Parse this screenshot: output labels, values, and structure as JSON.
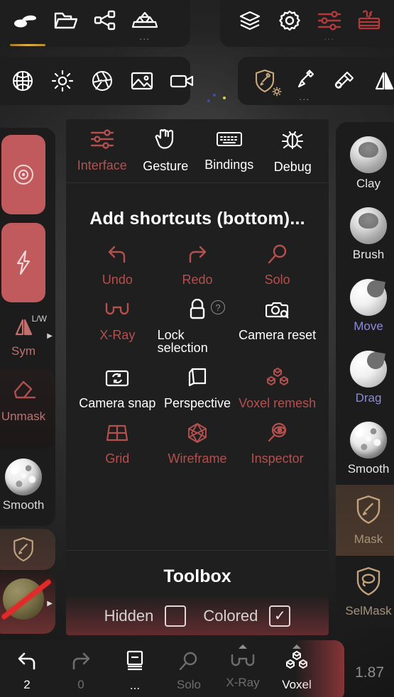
{
  "top_toolbar_left": [
    {
      "label": "Sculpt",
      "icon": "sculpt-shape-icon",
      "active": true
    },
    {
      "label": "Files",
      "icon": "folder-icon",
      "active": false
    },
    {
      "label": "Scene graph",
      "icon": "share-nodes-icon",
      "active": false
    },
    {
      "label": "Primitives",
      "icon": "stack-blocks-icon",
      "active": false,
      "more": "..."
    }
  ],
  "top_toolbar_right": [
    {
      "label": "Layers",
      "icon": "layers-icon",
      "color": "white"
    },
    {
      "label": "Settings",
      "icon": "gear-icon",
      "color": "white"
    },
    {
      "label": "Interface",
      "icon": "sliders-icon",
      "color": "red",
      "more": "..."
    },
    {
      "label": "Toolbox",
      "icon": "toolbox-icon",
      "color": "red"
    }
  ],
  "second_toolbar_left": [
    {
      "label": "Environment",
      "icon": "globe-grid-icon"
    },
    {
      "label": "Light",
      "icon": "sun-icon"
    },
    {
      "label": "Aperture",
      "icon": "aperture-icon"
    },
    {
      "label": "Background image",
      "icon": "image-icon"
    },
    {
      "label": "Video",
      "icon": "video-camera-icon"
    }
  ],
  "second_toolbar_right": [
    {
      "label": "Mask",
      "icon": "shield-brush-icon",
      "color": "gold",
      "badge": "gear-badge"
    },
    {
      "label": "Paint",
      "icon": "paintbrush-icon",
      "color": "white",
      "more": "..."
    },
    {
      "label": "Fill",
      "icon": "paint-bucket-icon",
      "color": "white"
    },
    {
      "label": "Mirror",
      "icon": "mirror-icon",
      "color": "white"
    }
  ],
  "left_sidebar": {
    "sliders": [
      {
        "name": "radius",
        "icon": "radius-target-icon",
        "color": "#c05a5c"
      },
      {
        "name": "intensity",
        "icon": "lightning-bolt-icon",
        "color": "#c05a5c"
      }
    ],
    "symmetry": {
      "label": "Sym",
      "badge": "L/W",
      "icon": "mirror-icon",
      "arrow": "▶"
    },
    "items": [
      {
        "label": "Unmask",
        "icon": "eraser-icon",
        "state": "red"
      },
      {
        "label": "Smooth",
        "icon": "rough-sphere-icon",
        "state": "white"
      },
      {
        "label": "Mask",
        "icon": "shield-brush-icon",
        "state": "selected"
      },
      {
        "label": "Matcap off",
        "icon": "material-sphere-strike-icon",
        "state": "disabled",
        "arrow": "▶"
      }
    ]
  },
  "right_sidebar": {
    "brushes": [
      {
        "label": "Clay",
        "icon": "clay-sphere-icon",
        "selected": false,
        "accent": false
      },
      {
        "label": "Brush",
        "icon": "brush-sphere-icon",
        "selected": false,
        "accent": false
      },
      {
        "label": "Move",
        "icon": "move-sphere-icon",
        "selected": false,
        "accent": true
      },
      {
        "label": "Drag",
        "icon": "drag-sphere-icon",
        "selected": false,
        "accent": true
      },
      {
        "label": "Smooth",
        "icon": "rough-sphere-icon",
        "selected": false,
        "accent": false
      },
      {
        "label": "Mask",
        "icon": "shield-brush-icon",
        "selected": true,
        "accent": false
      },
      {
        "label": "SelMask",
        "icon": "shield-lasso-icon",
        "selected": false,
        "accent": false
      }
    ]
  },
  "panel": {
    "tabs": [
      {
        "label": "Interface",
        "icon": "sliders-icon",
        "active": true
      },
      {
        "label": "Gesture",
        "icon": "hand-gesture-icon",
        "active": false
      },
      {
        "label": "Bindings",
        "icon": "keyboard-icon",
        "active": false
      },
      {
        "label": "Debug",
        "icon": "bug-icon",
        "active": false
      }
    ],
    "section_title": "Add shortcuts (bottom)...",
    "shortcuts": [
      {
        "label": "Undo",
        "icon": "undo-arrow-icon",
        "added": false
      },
      {
        "label": "Redo",
        "icon": "redo-arrow-icon",
        "added": false
      },
      {
        "label": "Solo",
        "icon": "magnifier-icon",
        "added": false
      },
      {
        "label": "X-Ray",
        "icon": "glasses-icon",
        "added": false
      },
      {
        "label": "Lock selection",
        "icon": "padlock-icon",
        "added": true,
        "help": "?"
      },
      {
        "label": "Camera reset",
        "icon": "camera-search-icon",
        "added": true
      },
      {
        "label": "Camera snap",
        "icon": "camera-snap-icon",
        "added": true
      },
      {
        "label": "Perspective",
        "icon": "cube-icon",
        "added": true
      },
      {
        "label": "Voxel remesh",
        "icon": "voxel-cubes-icon",
        "added": false
      },
      {
        "label": "Grid",
        "icon": "grid-icon",
        "added": false
      },
      {
        "label": "Wireframe",
        "icon": "wireframe-icon",
        "added": false
      },
      {
        "label": "Inspector",
        "icon": "eye-magnifier-icon",
        "added": false
      }
    ],
    "footer": {
      "title": "Toolbox",
      "hidden_label": "Hidden",
      "hidden_checked": false,
      "colored_label": "Colored",
      "colored_checked": true,
      "check_glyph": "✓"
    }
  },
  "bottom_bar": {
    "items": [
      {
        "label": "2",
        "icon": "undo-arrow-icon",
        "dim": false,
        "caret": false
      },
      {
        "label": "0",
        "icon": "redo-arrow-icon",
        "dim": true,
        "caret": false
      },
      {
        "label": "...",
        "icon": "layers-book-icon",
        "dim": false,
        "caret": false
      },
      {
        "label": "Solo",
        "icon": "magnifier-icon",
        "dim": true,
        "caret": false
      },
      {
        "label": "X-Ray",
        "icon": "glasses-icon",
        "dim": true,
        "caret": true
      },
      {
        "label": "Voxel",
        "icon": "voxel-cubes-icon",
        "dim": false,
        "caret": true
      }
    ],
    "zoom_value": "1.87"
  },
  "colors": {
    "accent_red": "#b4504e",
    "accent_gold": "#c2a27c",
    "accent_blue": "#8b8bd6",
    "panel_bg": "#1f1f1f",
    "slider_red": "#c05a5c"
  }
}
